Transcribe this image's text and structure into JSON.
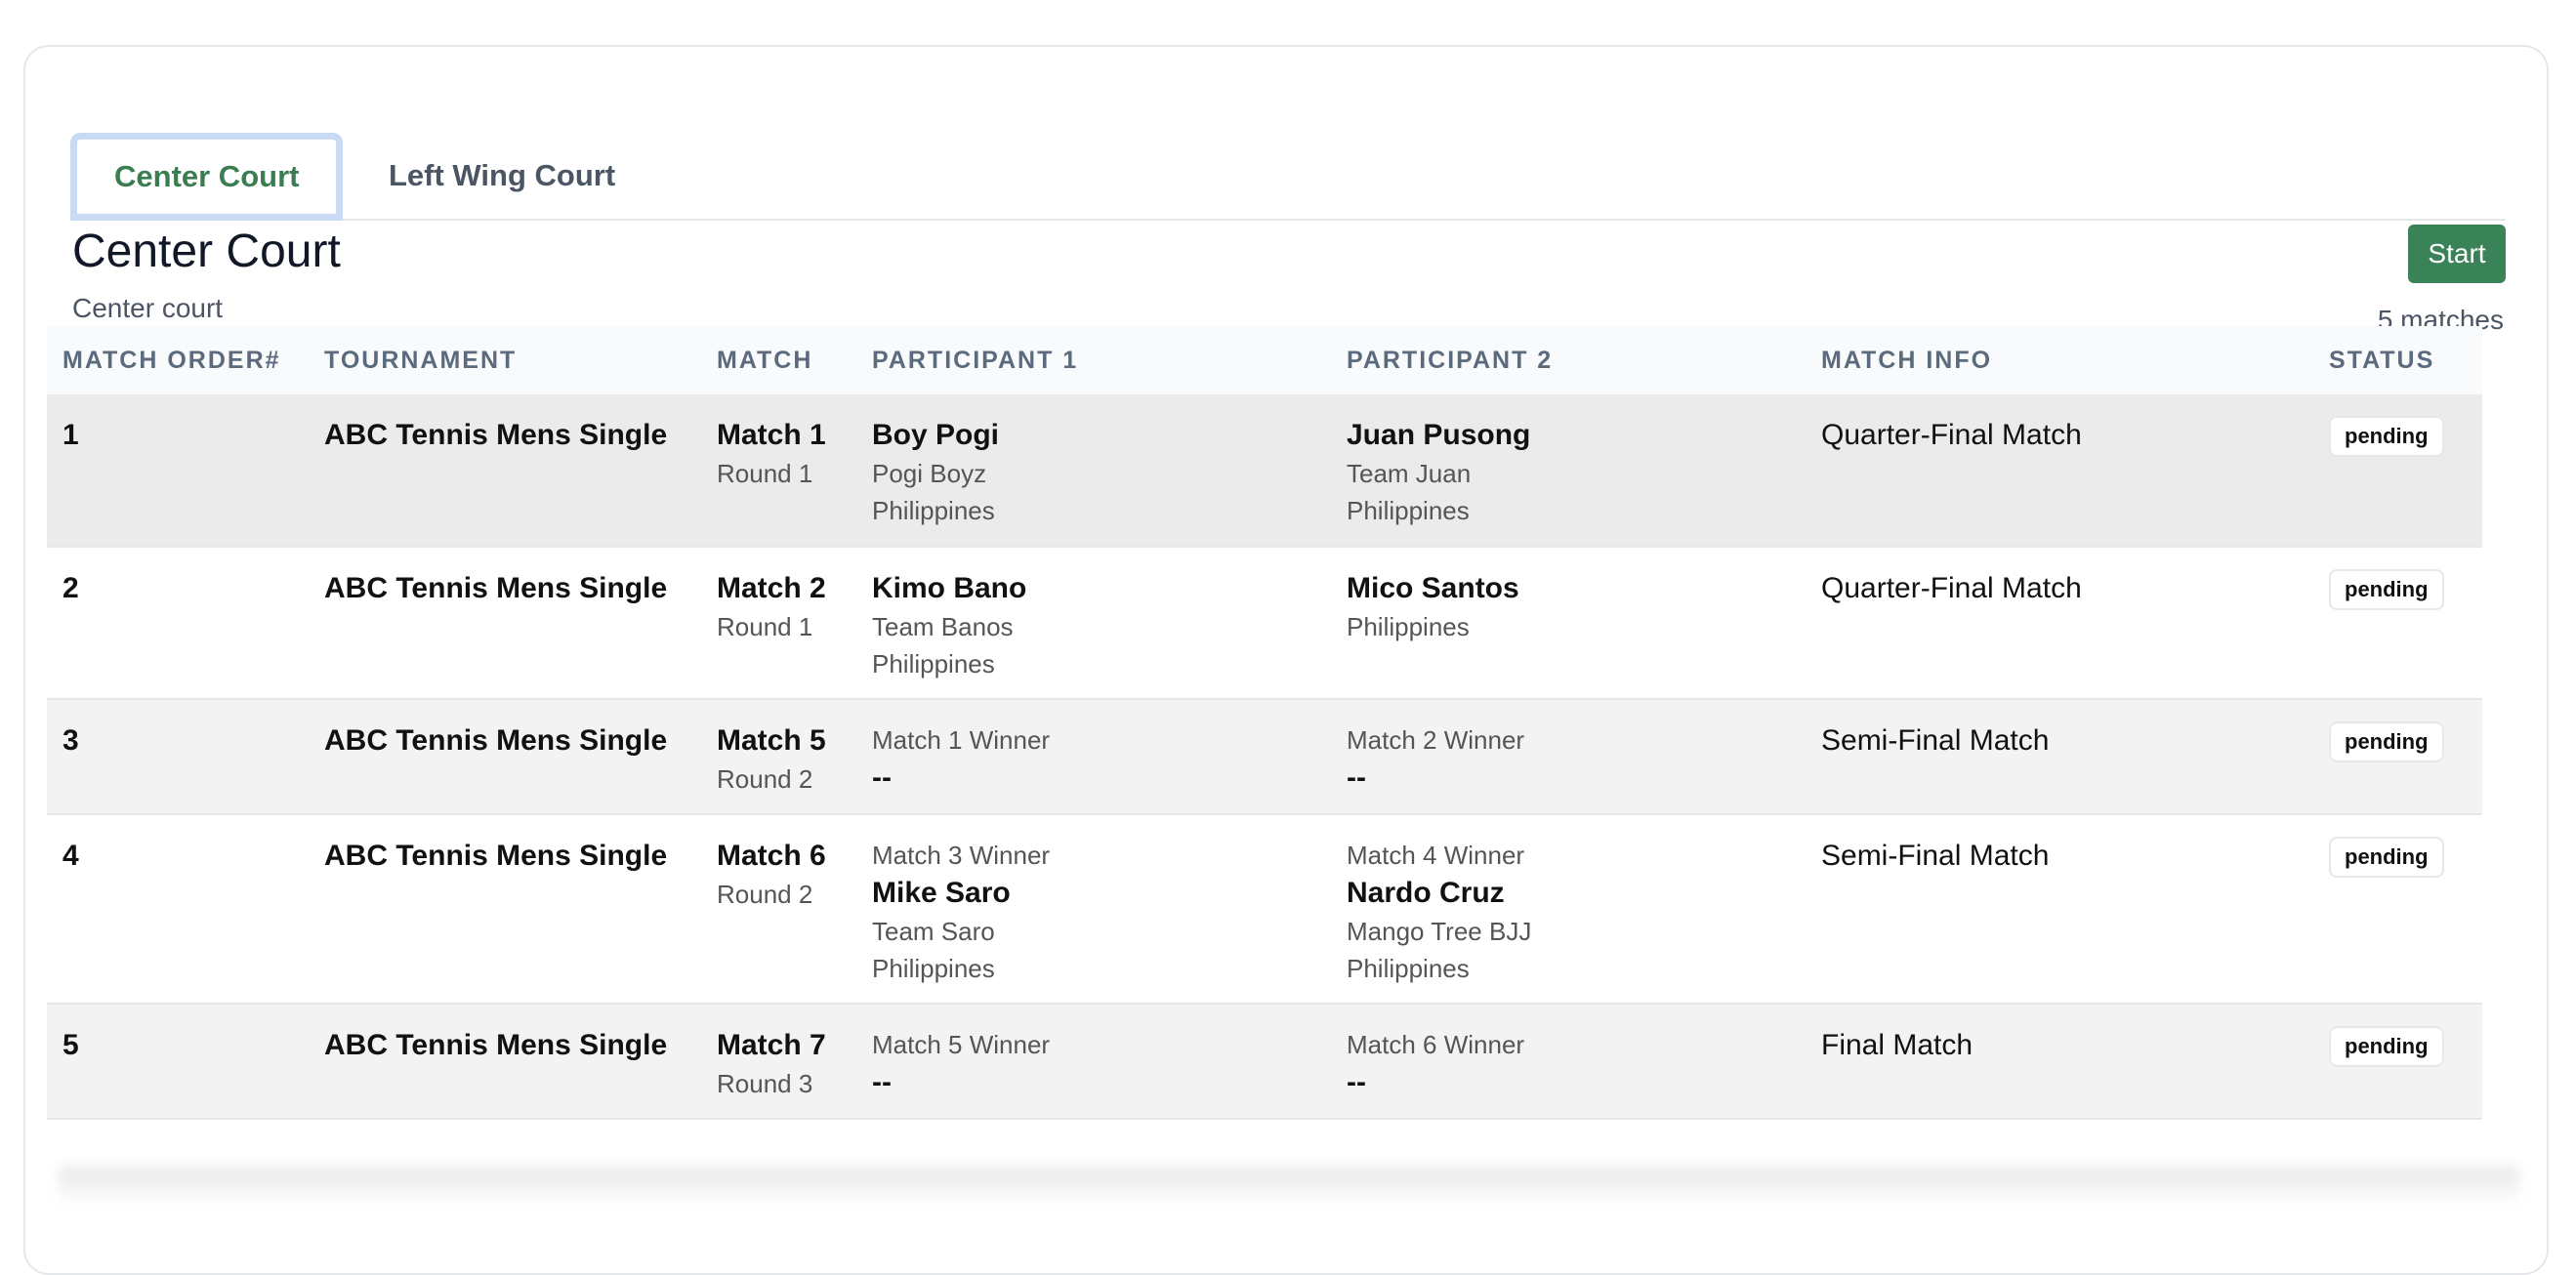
{
  "tabs": [
    {
      "label": "Center Court",
      "active": true
    },
    {
      "label": "Left Wing Court",
      "active": false
    }
  ],
  "court": {
    "title": "Center Court",
    "subtitle": "Center court",
    "start_label": "Start",
    "match_count": "5 matches"
  },
  "table": {
    "headers": [
      "MATCH ORDER#",
      "TOURNAMENT",
      "MATCH",
      "PARTICIPANT 1",
      "PARTICIPANT 2",
      "MATCH INFO",
      "STATUS"
    ],
    "rows": [
      {
        "order": "1",
        "tournament": "ABC Tennis Mens Single",
        "match": "Match 1",
        "round": "Round 1",
        "p1": {
          "label": "",
          "name": "Boy Pogi",
          "team": "Pogi Boyz",
          "country": "Philippines"
        },
        "p2": {
          "label": "",
          "name": "Juan Pusong",
          "team": "Team Juan",
          "country": "Philippines"
        },
        "info": "Quarter-Final Match",
        "status": "pending"
      },
      {
        "order": "2",
        "tournament": "ABC Tennis Mens Single",
        "match": "Match 2",
        "round": "Round 1",
        "p1": {
          "label": "",
          "name": "Kimo Bano",
          "team": "Team Banos",
          "country": "Philippines"
        },
        "p2": {
          "label": "",
          "name": "Mico Santos",
          "team": "",
          "country": "Philippines"
        },
        "info": "Quarter-Final Match",
        "status": "pending"
      },
      {
        "order": "3",
        "tournament": "ABC Tennis Mens Single",
        "match": "Match 5",
        "round": "Round 2",
        "p1": {
          "label": "Match 1 Winner",
          "name": "--",
          "team": "",
          "country": ""
        },
        "p2": {
          "label": "Match 2 Winner",
          "name": "--",
          "team": "",
          "country": ""
        },
        "info": "Semi-Final Match",
        "status": "pending"
      },
      {
        "order": "4",
        "tournament": "ABC Tennis Mens Single",
        "match": "Match 6",
        "round": "Round 2",
        "p1": {
          "label": "Match 3 Winner",
          "name": "Mike Saro",
          "team": "Team Saro",
          "country": "Philippines"
        },
        "p2": {
          "label": "Match 4 Winner",
          "name": "Nardo Cruz",
          "team": "Mango Tree BJJ",
          "country": "Philippines"
        },
        "info": "Semi-Final Match",
        "status": "pending"
      },
      {
        "order": "5",
        "tournament": "ABC Tennis Mens Single",
        "match": "Match 7",
        "round": "Round 3",
        "p1": {
          "label": "Match 5 Winner",
          "name": "--",
          "team": "",
          "country": ""
        },
        "p2": {
          "label": "Match 6 Winner",
          "name": "--",
          "team": "",
          "country": ""
        },
        "info": "Final Match",
        "status": "pending"
      }
    ]
  },
  "colors": {
    "accent": "#3a7d50",
    "start_button": "#3a8257",
    "focus_ring": "#c9daf5"
  }
}
